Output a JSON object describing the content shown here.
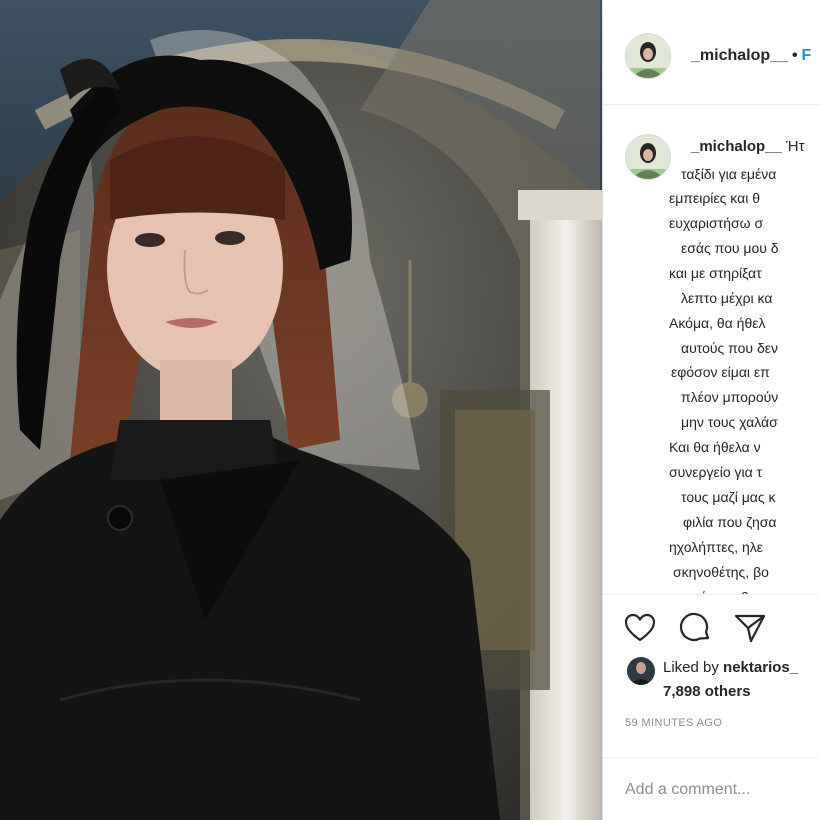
{
  "post": {
    "username": "_michalop__",
    "follow_label": "F"
  },
  "caption": {
    "username": "_michalop__",
    "first_word": "Ήτ",
    "lines": [
      "ταξίδι για εμένα",
      "εμπειρίες και θ",
      "ευχαριστήσω σ",
      "εσάς που μου δ",
      "και με στηρίξατ",
      "λεπτο μέχρι κα",
      "Ακόμα, θα ήθελ",
      "αυτούς που δεν",
      "εφόσον είμαι επ",
      "πλέον μπορούν",
      "μην τους χαλάσ",
      "Και θα ήθελα ν",
      "συνεργείο για τ",
      "τους μαζί μας κ",
      "φιλία που ζησα",
      "ηχολήπτες, ηλε",
      "σκηνοθέτης, βο",
      "συντάκτες, βοη"
    ]
  },
  "actions": {
    "like_icon": "heart-icon",
    "comment_icon": "comment-bubble-icon",
    "share_icon": "paper-plane-icon"
  },
  "likes": {
    "prefix": "Liked by ",
    "user": "nektarios_",
    "others": "7,898 others"
  },
  "timestamp": "59 MINUTES AGO",
  "comment": {
    "placeholder": "Add a comment..."
  },
  "colors": {
    "link_blue": "#0095f6",
    "text": "#262626",
    "muted": "#8e8e8e",
    "border": "#dbdbdb"
  }
}
